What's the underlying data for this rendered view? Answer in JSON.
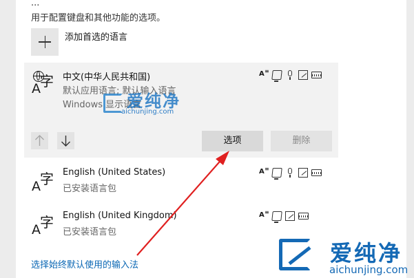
{
  "intro": {
    "line1": "...",
    "line2": "用于配置键盘和其他功能的选项。"
  },
  "add_language": {
    "label": "添加首选的语言"
  },
  "languages": [
    {
      "name": "中文(中华人民共和国)",
      "sub1": "默认应用语言; 默认输入语言",
      "sub2": "Windows 显示语言"
    },
    {
      "name": "English (United States)",
      "sub1": "已安装语言包"
    },
    {
      "name": "English (United Kingdom)",
      "sub1": "已安装语言包"
    }
  ],
  "glyph": {
    "letter": "A",
    "char": "字"
  },
  "buttons": {
    "options": "选项",
    "remove": "删除"
  },
  "link": {
    "default_input": "选择始终默认使用的输入法"
  },
  "watermark": {
    "small_text": "爱纯净",
    "small_url": "aichunjing.com",
    "big_text": "爱纯净",
    "big_url": "aichunjing.com"
  },
  "colors": {
    "link": "#0a67b4",
    "annotation_arrow": "#e02020",
    "watermark": "#1469b5"
  }
}
